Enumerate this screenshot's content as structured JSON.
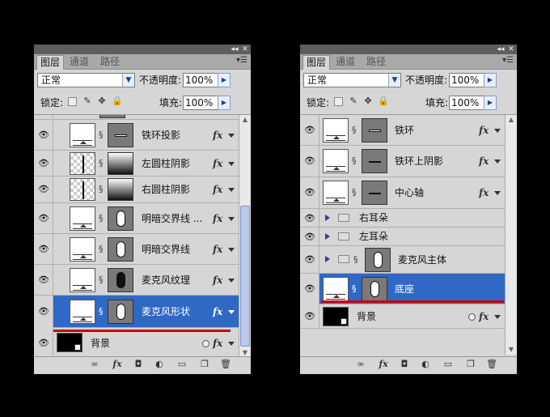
{
  "tabs": [
    "图层",
    "通道",
    "路径"
  ],
  "controls": {
    "blend_mode": "正常",
    "opacity_label": "不透明度:",
    "opacity_value": "100%",
    "lock_label": "锁定:",
    "fill_label": "填充:",
    "fill_value": "100%"
  },
  "fx_label": "fx",
  "left_panel": {
    "layers": [
      {
        "name": "铁环投影",
        "fx": true
      },
      {
        "name": "左圆柱阴影",
        "fx": true
      },
      {
        "name": "右圆柱阴影",
        "fx": true
      },
      {
        "name": "明暗交界线 ...",
        "fx": true
      },
      {
        "name": "明暗交界线",
        "fx": true
      },
      {
        "name": "麦克风纹理",
        "fx": true
      },
      {
        "name": "麦克风形状",
        "fx": true,
        "selected": true
      },
      {
        "name": "背景",
        "fx": true
      }
    ]
  },
  "right_panel": {
    "layers": [
      {
        "name": "铁环",
        "fx": true
      },
      {
        "name": "铁环上阴影",
        "fx": true
      },
      {
        "name": "中心轴",
        "fx": true
      },
      {
        "name": "右耳朵"
      },
      {
        "name": "左耳朵"
      },
      {
        "name": "麦克风主体"
      },
      {
        "name": "底座",
        "selected": true
      },
      {
        "name": "背景",
        "fx": true
      }
    ]
  },
  "colors": {
    "selection": "#2f68c5",
    "red_marker": "#cc0000",
    "panel_bg": "#d6d6d6"
  }
}
